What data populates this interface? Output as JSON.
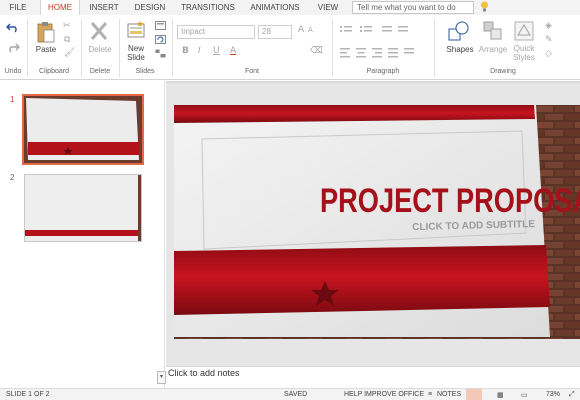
{
  "tabs": [
    "FILE",
    "HOME",
    "INSERT",
    "DESIGN",
    "TRANSITIONS",
    "ANIMATIONS",
    "VIEW"
  ],
  "tell_me": "Tell me what you want to do",
  "ribbon": {
    "undo_label": "Undo",
    "paste": "Paste",
    "clipboard": "Clipboard",
    "delete_btn": "Delete",
    "delete_grp": "Delete",
    "new_slide_1": "New",
    "new_slide_2": "Slide",
    "slides": "Slides",
    "font_name": "Impact",
    "font_size": "28",
    "font": "Font",
    "paragraph": "Paragraph",
    "shapes": "Shapes",
    "arrange": "Arrange",
    "quick_styles_1": "Quick",
    "quick_styles_2": "Styles",
    "drawing": "Drawing",
    "bold": "B",
    "italic": "I",
    "underline": "U",
    "font_color": "A"
  },
  "thumbnails": [
    {
      "number": "1"
    },
    {
      "number": "2"
    }
  ],
  "slide": {
    "title": "PROJECT PROPOSAL",
    "subtitle": "CLICK TO ADD SUBTITLE"
  },
  "notes_placeholder": "Click to add notes",
  "status": {
    "slide_of": "SLIDE 1 OF 2",
    "saved": "SAVED",
    "help": "HELP IMPROVE OFFICE",
    "notes": "NOTES",
    "zoom": "73%"
  },
  "colors": {
    "accent": "#c43e1c",
    "slide_red": "#b3121b",
    "title_red": "#a5111a"
  }
}
